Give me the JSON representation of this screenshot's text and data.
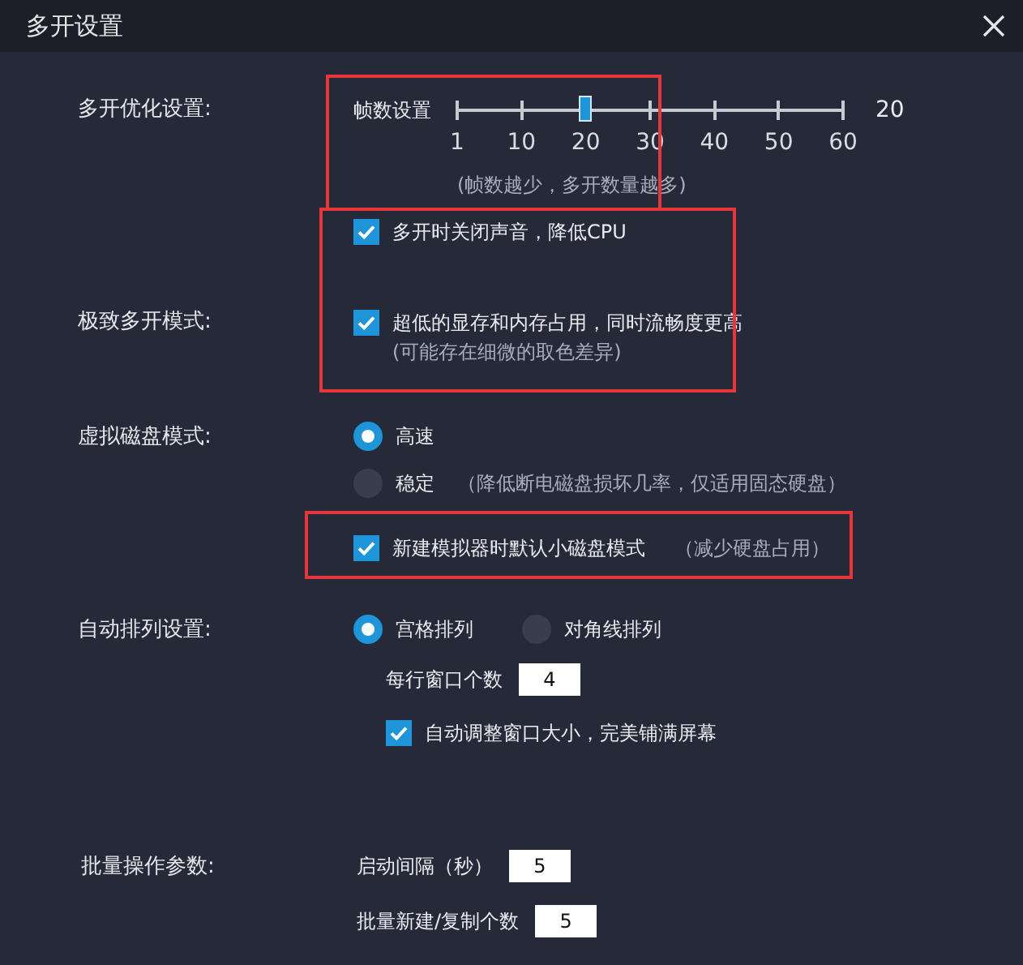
{
  "window": {
    "title": "多开设置"
  },
  "optimization": {
    "label": "多开优化设置:",
    "frame_rate": {
      "label": "帧数设置",
      "level": 0.333,
      "ticks": [
        "1",
        "10",
        "20",
        "30",
        "40",
        "50",
        "60"
      ],
      "value": "20",
      "hint": "(帧数越少，多开数量越多)",
      "highlighted": true
    }
  },
  "low_resource": {
    "highlighted": true,
    "mute": {
      "label": "多开时关闭声音，降低CPU",
      "checked": true
    },
    "extreme_mode": {
      "label": "极致多开模式:",
      "option": {
        "label": "超低的显存和内存占用，同时流畅度更高",
        "note": "(可能存在细微的取色差异)",
        "checked": true
      }
    }
  },
  "disk_mode": {
    "label": "虚拟磁盘模式:",
    "options": [
      {
        "label": "高速",
        "selected": true
      },
      {
        "label": "稳定",
        "note": "（降低断电磁盘损坏几率，仅适用固态硬盘）",
        "selected": false
      }
    ],
    "small_disk": {
      "label": "新建模拟器时默认小磁盘模式",
      "note": "（减少硬盘占用）",
      "checked": true,
      "highlighted": true
    }
  },
  "arrange": {
    "label": "自动排列设置:",
    "options": [
      {
        "label": "宫格排列",
        "selected": true
      },
      {
        "label": "对角线排列",
        "selected": false
      }
    ],
    "per_row": {
      "label": "每行窗口个数",
      "value": "4"
    },
    "auto_resize": {
      "label": "自动调整窗口大小，完美铺满屏幕",
      "checked": true
    }
  },
  "batch": {
    "label": "批量操作参数:",
    "fields": [
      {
        "label": "启动间隔（秒）",
        "value": "5"
      },
      {
        "label": "批量新建/复制个数",
        "value": "5"
      }
    ]
  }
}
